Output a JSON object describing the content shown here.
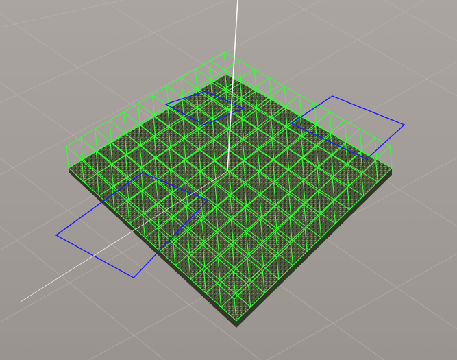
{
  "scene": {
    "background_color": "#a39d99",
    "background_top_color": "#aaa5a1",
    "background_bottom_color": "#9a9490",
    "ground_grid_color": "#b9b5b1",
    "terrain_color": "#4e5a3e",
    "terrain_dark_color": "#2f3a26",
    "terrain_light_color": "#7e8a62",
    "wireframe_cube_color": "#33ff33",
    "selection_outline_color": "#1a1aff",
    "vertical_axis_color": "#ffffff",
    "grid_cells": {
      "rows": 11,
      "cols": 11
    }
  }
}
